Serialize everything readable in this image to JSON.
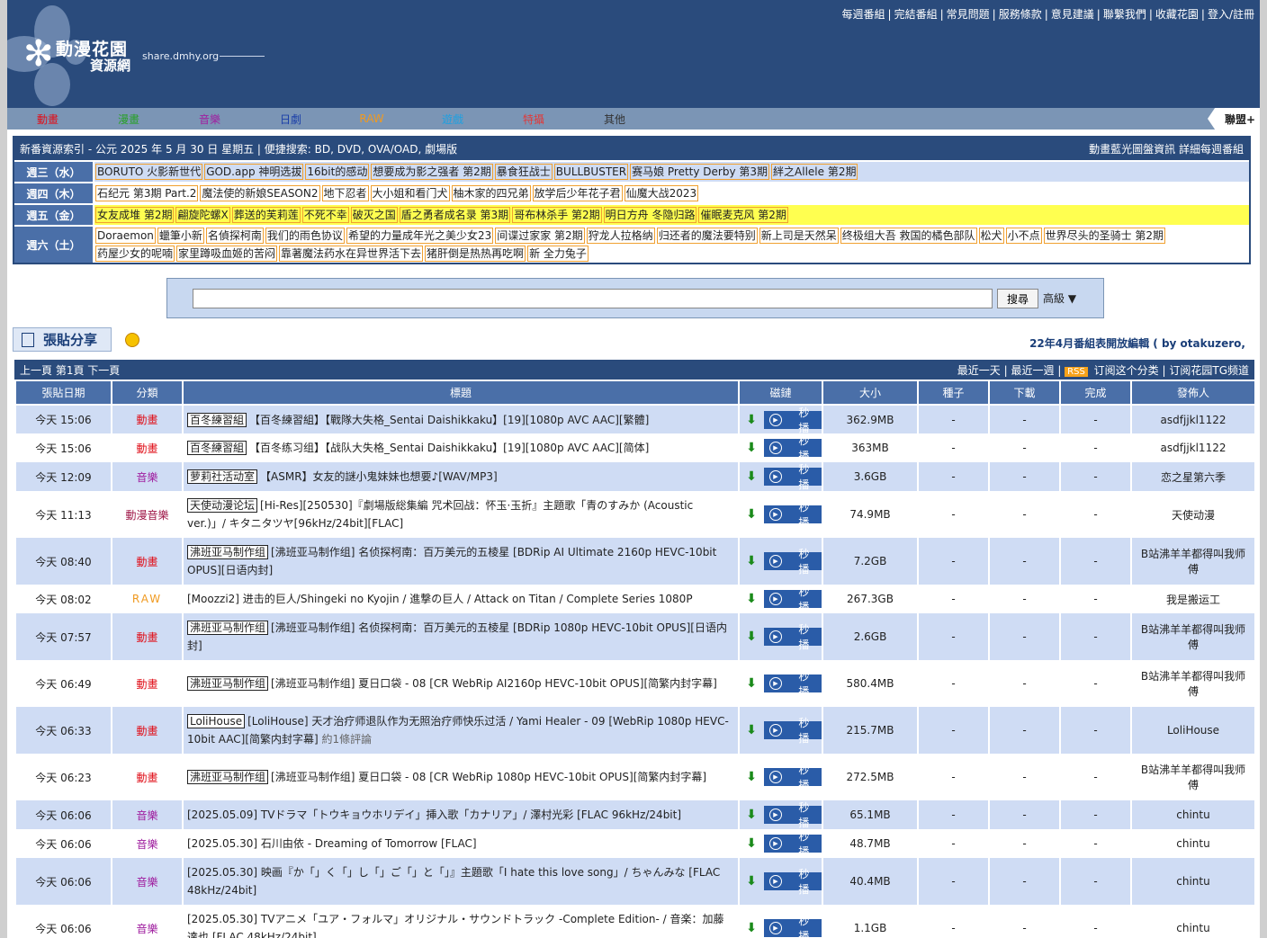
{
  "header": {
    "logo_title": "動漫花園",
    "logo_sub": "資源網",
    "logo_url": "share.dmhy.org",
    "toplinks": [
      "每週番組",
      "完結番組",
      "常見問題",
      "服務條款",
      "意見建議",
      "聯繫我們",
      "收藏花園",
      "登入/註冊"
    ]
  },
  "nav": {
    "items": [
      {
        "label": "動畫",
        "color": "#e0101a"
      },
      {
        "label": "漫畫",
        "color": "#2aa02a"
      },
      {
        "label": "音樂",
        "color": "#a020a0"
      },
      {
        "label": "日劇",
        "color": "#1a3ea8"
      },
      {
        "label": "RAW",
        "color": "#f09a20"
      },
      {
        "label": "遊戲",
        "color": "#20a0e0"
      },
      {
        "label": "特攝",
        "color": "#e03a3a"
      },
      {
        "label": "其他",
        "color": "#333333"
      }
    ],
    "alliance": "聯盟+"
  },
  "index": {
    "title": "新番資源索引 - 公元 2025 年 5 月 30 日 星期五 | 便捷搜索: BD, DVD, OVA/OAD, 劇場版",
    "right_links": "動畫藍光圖盤資訊 詳細每週番組",
    "days": [
      {
        "label": "週三（水）",
        "items": [
          "BORUTO 火影新世代",
          "GOD.app 神明选拔",
          "16bit的感动",
          "想要成为影之强者 第2期",
          "暴食狂战士",
          "BULLBUSTER",
          "赛马娘 Pretty Derby 第3期",
          "絆之Allele 第2期"
        ]
      },
      {
        "label": "週四（木）",
        "items": [
          "石纪元 第3期 Part.2",
          "魔法使的新娘SEASON2",
          "地下忍者",
          "大小姐和看门犬",
          "柚木家的四兄弟",
          "放学后少年花子君",
          "仙魔大战2023"
        ]
      },
      {
        "label": "週五（金）",
        "items": [
          "女友成堆 第2期",
          "翩旋陀螺X",
          "葬送的芙莉莲",
          "不死不幸",
          "破灭之国",
          "盾之勇者成名录 第3期",
          "哥布林杀手 第2期",
          "明日方舟 冬隐归路",
          "催眠麦克风 第2期"
        ]
      },
      {
        "label": "週六（土）",
        "items": [
          "Doraemon",
          "蠟筆小新",
          "名偵探柯南",
          "我们的雨色协议",
          "希望的力量成年光之美少女23",
          "间谍过家家 第2期",
          "狩龙人拉格纳",
          "归还者的魔法要特别",
          "新上司是天然呆",
          "终极组大吾 救国的橘色部队",
          "松犬",
          "小不点",
          "世界尽头的圣骑士 第2期",
          "药屋少女的呢喃",
          "家里蹲吸血姬的苦闷",
          "靠著魔法药水在异世界活下去",
          "猪肝倒是热热再吃啊",
          "新 全力兔子"
        ]
      }
    ]
  },
  "search": {
    "placeholder": "",
    "button": "搜尋",
    "advanced": "高級 ▼"
  },
  "post": {
    "button": "張貼分享",
    "announce": "22年4月番組表開放編輯 ( by otakuzero,"
  },
  "list": {
    "pager": "上一頁 第1頁 下一頁",
    "right": {
      "recent_day": "最近一天",
      "recent_week": "最近一週",
      "rss": "RSS",
      "subscribe_cat": "订阅这个分类",
      "subscribe_tg": "订阅花园TG频道"
    },
    "columns": [
      "張貼日期",
      "分類",
      "標題",
      "磁鏈",
      "大小",
      "種子",
      "下載",
      "完成",
      "發佈人"
    ],
    "play_label": "秒 播",
    "rows": [
      {
        "date": "今天 15:06",
        "cat": "動畫",
        "cat_color": "#e0101a",
        "team": "百冬練習組",
        "title": "【百冬練習組】【戰隊大失格_Sentai Daishikkaku】[19][1080p AVC AAC][繁體]",
        "size": "362.9MB",
        "seeds": "-",
        "dl": "-",
        "done": "-",
        "publisher": "asdfjjkl1122"
      },
      {
        "date": "今天 15:06",
        "cat": "動畫",
        "cat_color": "#e0101a",
        "team": "百冬練習組",
        "title": "【百冬练习组】【战队大失格_Sentai Daishikkaku】[19][1080p AVC AAC][简体]",
        "size": "363MB",
        "seeds": "-",
        "dl": "-",
        "done": "-",
        "publisher": "asdfjjkl1122"
      },
      {
        "date": "今天 12:09",
        "cat": "音樂",
        "cat_color": "#a020a0",
        "team": "萝莉社活动室",
        "title": "【ASMR】女友的謎小鬼妹妹也想要♪[WAV/MP3]",
        "size": "3.6GB",
        "seeds": "-",
        "dl": "-",
        "done": "-",
        "publisher": "恋之星第六季"
      },
      {
        "date": "今天 11:13",
        "cat": "動漫音樂",
        "cat_color": "#a01a4a",
        "team": "天使动漫论坛",
        "title": "[Hi-Res][250530]『劇場版総集編 咒术回战：怀玉·玉折』主題歌「青のすみか (Acoustic ver.)」/ キタニタツヤ[96kHz/24bit][FLAC]",
        "size": "74.9MB",
        "seeds": "-",
        "dl": "-",
        "done": "-",
        "publisher": "天使动漫"
      },
      {
        "date": "今天 08:40",
        "cat": "動畫",
        "cat_color": "#e0101a",
        "team": "沸班亚马制作组",
        "title": "[沸班亚马制作组] 名侦探柯南：百万美元的五棱星 [BDRip AI Ultimate 2160p HEVC-10bit OPUS][日语内封]",
        "size": "7.2GB",
        "seeds": "-",
        "dl": "-",
        "done": "-",
        "publisher": "B站沸羊羊都得叫我师傅"
      },
      {
        "date": "今天 08:02",
        "cat": "RAW",
        "cat_color": "#f09a20",
        "team": "",
        "title": "[Moozzi2] 进击的巨人/Shingeki no Kyojin / 進撃の巨人 / Attack on Titan / Complete Series 1080P",
        "size": "267.3GB",
        "seeds": "-",
        "dl": "-",
        "done": "-",
        "publisher": "我是搬运工"
      },
      {
        "date": "今天 07:57",
        "cat": "動畫",
        "cat_color": "#e0101a",
        "team": "沸班亚马制作组",
        "title": "[沸班亚马制作组] 名侦探柯南：百万美元的五棱星 [BDRip 1080p HEVC-10bit OPUS][日语内封]",
        "size": "2.6GB",
        "seeds": "-",
        "dl": "-",
        "done": "-",
        "publisher": "B站沸羊羊都得叫我师傅"
      },
      {
        "date": "今天 06:49",
        "cat": "動畫",
        "cat_color": "#e0101a",
        "team": "沸班亚马制作组",
        "title": "[沸班亚马制作组] 夏日口袋 - 08 [CR WebRip AI2160p HEVC-10bit OPUS][简繁内封字幕]",
        "size": "580.4MB",
        "seeds": "-",
        "dl": "-",
        "done": "-",
        "publisher": "B站沸羊羊都得叫我师傅"
      },
      {
        "date": "今天 06:33",
        "cat": "動畫",
        "cat_color": "#e0101a",
        "team": "LoliHouse",
        "title": "[LoliHouse] 天才治疗师退队作为无照治疗师快乐过活 / Yami Healer - 09 [WebRip 1080p HEVC-10bit AAC][简繁内封字幕]",
        "comment": "約1條評論",
        "size": "215.7MB",
        "seeds": "-",
        "dl": "-",
        "done": "-",
        "publisher": "LoliHouse"
      },
      {
        "date": "今天 06:23",
        "cat": "動畫",
        "cat_color": "#e0101a",
        "team": "沸班亚马制作组",
        "title": "[沸班亚马制作组] 夏日口袋 - 08 [CR WebRip 1080p HEVC-10bit OPUS][简繁内封字幕]",
        "size": "272.5MB",
        "seeds": "-",
        "dl": "-",
        "done": "-",
        "publisher": "B站沸羊羊都得叫我师傅"
      },
      {
        "date": "今天 06:06",
        "cat": "音樂",
        "cat_color": "#a020a0",
        "team": "",
        "title": "[2025.05.09] TVドラマ「トウキョウホリデイ」挿入歌「カナリア」/ 澤村光彩 [FLAC 96kHz/24bit]",
        "size": "65.1MB",
        "seeds": "-",
        "dl": "-",
        "done": "-",
        "publisher": "chintu"
      },
      {
        "date": "今天 06:06",
        "cat": "音樂",
        "cat_color": "#a020a0",
        "team": "",
        "title": "[2025.05.30] 石川由依 - Dreaming of Tomorrow [FLAC]",
        "size": "48.7MB",
        "seeds": "-",
        "dl": "-",
        "done": "-",
        "publisher": "chintu"
      },
      {
        "date": "今天 06:06",
        "cat": "音樂",
        "cat_color": "#a020a0",
        "team": "",
        "title": "[2025.05.30] 映画『か「」く「」し「」ご「」と「」』主題歌「I hate this love song」/ ちゃんみな [FLAC 48kHz/24bit]",
        "size": "40.4MB",
        "seeds": "-",
        "dl": "-",
        "done": "-",
        "publisher": "chintu"
      },
      {
        "date": "今天 06:06",
        "cat": "音樂",
        "cat_color": "#a020a0",
        "team": "",
        "title": "[2025.05.30] TVアニメ「ユア・フォルマ」オリジナル・サウンドトラック -Complete Edition- / 音楽：加藤達也 [FLAC 48kHz/24bit]",
        "size": "1.1GB",
        "seeds": "-",
        "dl": "-",
        "done": "-",
        "publisher": "chintu"
      }
    ]
  },
  "colors": {
    "header_bg": "#2a4b7c",
    "nav_bg": "#7b95b5",
    "row_alt": "#cfdcf4",
    "th_bg": "#4a6fa8"
  }
}
